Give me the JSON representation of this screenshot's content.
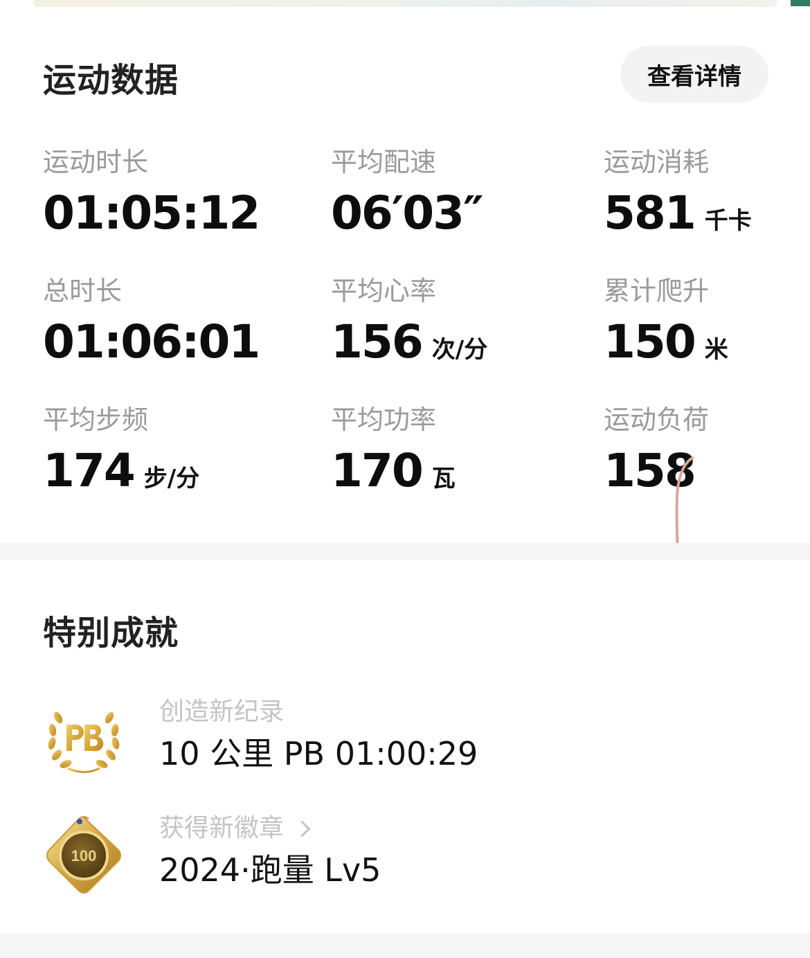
{
  "stats_section": {
    "title": "运动数据",
    "detail_button": "查看详情",
    "items": [
      {
        "label": "运动时长",
        "value": "01:05:12",
        "unit": ""
      },
      {
        "label": "平均配速",
        "value": "06′03″",
        "unit": ""
      },
      {
        "label": "运动消耗",
        "value": "581",
        "unit": "千卡"
      },
      {
        "label": "总时长",
        "value": "01:06:01",
        "unit": ""
      },
      {
        "label": "平均心率",
        "value": "156",
        "unit": "次/分"
      },
      {
        "label": "累计爬升",
        "value": "150",
        "unit": "米"
      },
      {
        "label": "平均步频",
        "value": "174",
        "unit": "步/分"
      },
      {
        "label": "平均功率",
        "value": "170",
        "unit": "瓦"
      },
      {
        "label": "运动负荷",
        "value": "158",
        "unit": ""
      }
    ]
  },
  "achievements_section": {
    "title": "特别成就",
    "items": [
      {
        "subtitle": "创造新纪录",
        "main": "10 公里 PB 01:00:29",
        "icon": "pb-laurel-icon"
      },
      {
        "subtitle": "获得新徽章",
        "main": "2024·跑量 Lv5",
        "icon": "medal-badge-icon",
        "badge_text": "100"
      }
    ]
  },
  "colors": {
    "label_gray": "#9a9a9a",
    "subtitle_gray": "#c4c4c4",
    "value_black": "#0d0d0d",
    "button_bg": "#f3f3f3",
    "gold": "#d8a83a",
    "pen_mark": "#dca59a"
  }
}
